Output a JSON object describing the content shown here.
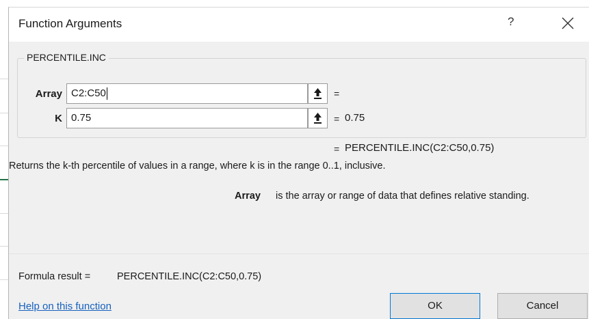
{
  "dialog": {
    "title": "Function Arguments",
    "help_glyph": "?",
    "function_name": "PERCENTILE.INC"
  },
  "arguments": [
    {
      "label": "Array",
      "value": "C2:C50",
      "equals": "=",
      "result": ""
    },
    {
      "label": "K",
      "value": "0.75",
      "equals": "=",
      "result": "0.75"
    }
  ],
  "formula_preview": {
    "equals": "=",
    "value": "PERCENTILE.INC(C2:C50,0.75)"
  },
  "description": "Returns the k-th percentile of values in a range, where k is in the range 0..1, inclusive.",
  "argument_help": {
    "name": "Array",
    "text": "is the array or range of data that defines relative standing."
  },
  "formula_result": {
    "label": "Formula result =",
    "value": "PERCENTILE.INC(C2:C50,0.75)"
  },
  "footer": {
    "help_link": "Help on this function",
    "ok_label": "OK",
    "cancel_label": "Cancel"
  },
  "colors": {
    "dialog_bg": "#f0f0f0",
    "link": "#1560bd",
    "ok_border": "#0078d7"
  },
  "icons": {
    "collapse": "collapse-dialog-arrow-icon",
    "close": "close-icon"
  }
}
